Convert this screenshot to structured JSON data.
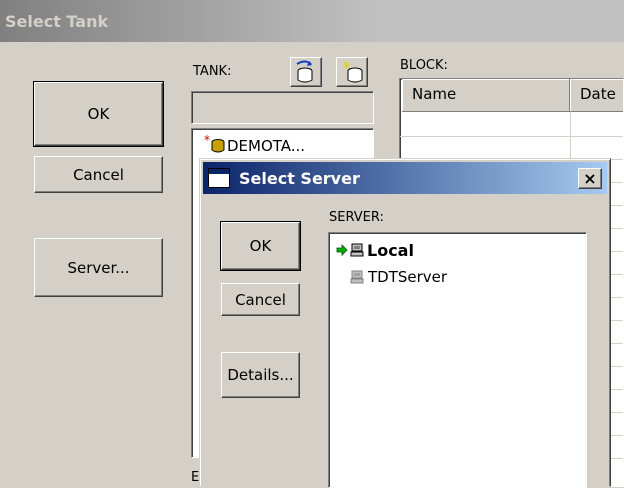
{
  "outer": {
    "title": "Select Tank",
    "ok_label": "OK",
    "cancel_label": "Cancel",
    "server_label": "Server...",
    "tank_label": "TANK:",
    "block_label": "BLOCK:",
    "block_columns": [
      "Name",
      "Date"
    ],
    "tank_items": [
      {
        "label": "DEMOTA...",
        "icon": "database-icon",
        "marker": "*"
      }
    ],
    "bottom_label_fragment": "E"
  },
  "dialog": {
    "title": "Select Server",
    "close_glyph": "×",
    "ok_label": "OK",
    "cancel_label": "Cancel",
    "details_label": "Details...",
    "server_label": "SERVER:",
    "servers": [
      {
        "label": "Local",
        "current": true,
        "icon": "computer-icon"
      },
      {
        "label": "TDTServer",
        "current": false,
        "icon": "computer-icon"
      }
    ]
  },
  "colors": {
    "titlebar_active_start": "#0a246a",
    "titlebar_active_end": "#a6caf0",
    "titlebar_inactive": "#808080",
    "current_arrow": "#00b000"
  }
}
